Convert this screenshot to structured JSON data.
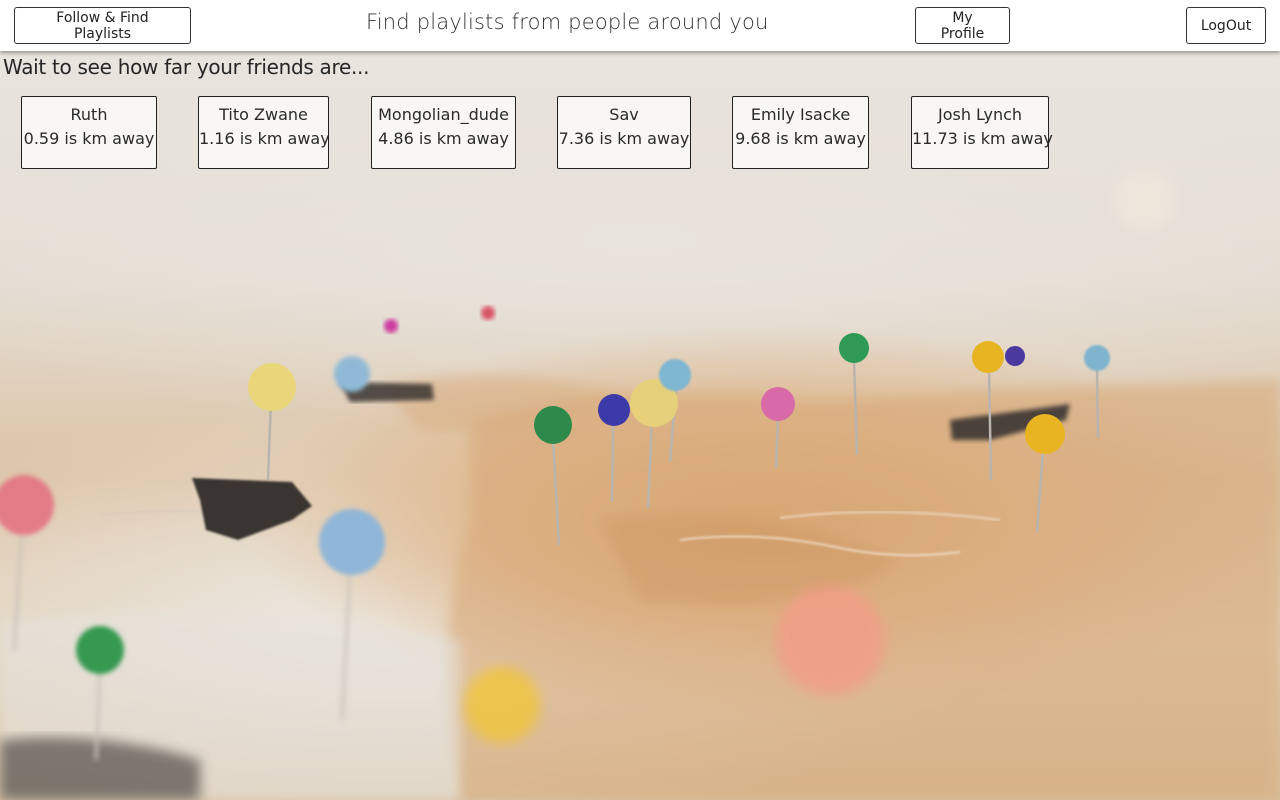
{
  "header": {
    "follow_button": "Follow & Find Playlists",
    "title": "Find playlists from people around you",
    "profile_button": "My Profile",
    "logout_button": "LogOut"
  },
  "main": {
    "subtitle": "Wait to see how far your friends are...",
    "friends": [
      {
        "name": "Ruth",
        "distance": "0.59 is km away"
      },
      {
        "name": "Tito Zwane",
        "distance": "1.16 is km away"
      },
      {
        "name": "Mongolian_dude",
        "distance": "4.86 is km away"
      },
      {
        "name": "Sav",
        "distance": "7.36 is km away"
      },
      {
        "name": "Emily Isacke",
        "distance": "9.68 is km away"
      },
      {
        "name": "Josh Lynch",
        "distance": "11.73 is km away"
      }
    ]
  },
  "background": {
    "description_icon": "map-with-pins-photo",
    "pin_colors": [
      "#e9d57a",
      "#8fb9d6",
      "#cc3aa0",
      "#d9546a",
      "#2d8a4a",
      "#3c3aa8",
      "#e7d07a",
      "#7fb6d2",
      "#d96aa8",
      "#2f9a55",
      "#e8b522",
      "#4a3aa0",
      "#e9b422",
      "#7fb4cf",
      "#e37b86",
      "#8fb6d8",
      "#34994f",
      "#f0c63a",
      "#f49b86"
    ]
  }
}
